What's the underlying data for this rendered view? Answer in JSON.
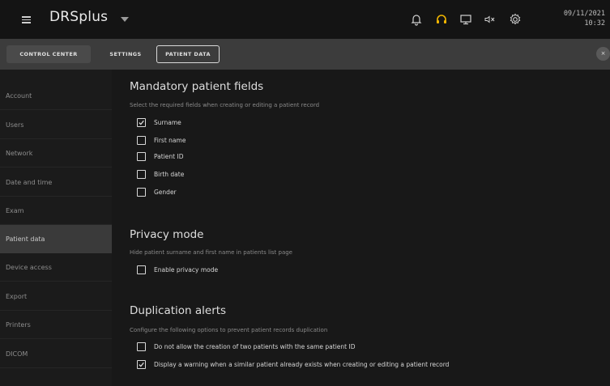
{
  "topbar": {
    "app_title": "DRSplus",
    "date": "09/11/2021",
    "time": "10:32",
    "icons": [
      "menu-icon",
      "bell-icon",
      "headset-icon",
      "monitor-icon",
      "speaker-muted-icon",
      "gear-icon"
    ],
    "headset_color": "#f2b600"
  },
  "tabs": [
    {
      "label": "CONTROL CENTER"
    },
    {
      "label": "SETTINGS"
    },
    {
      "label": "PATIENT DATA"
    }
  ],
  "close_label": "×",
  "sidebar": {
    "items": [
      {
        "label": "Account"
      },
      {
        "label": "Users"
      },
      {
        "label": "Network"
      },
      {
        "label": "Date and time"
      },
      {
        "label": "Exam"
      },
      {
        "label": "Patient data",
        "active": true
      },
      {
        "label": "Device access"
      },
      {
        "label": "Export"
      },
      {
        "label": "Printers"
      },
      {
        "label": "DICOM"
      }
    ]
  },
  "sections": {
    "mandatory": {
      "title": "Mandatory patient fields",
      "subtitle": "Select the required fields when creating or editing a patient record",
      "fields": [
        {
          "label": "Surname",
          "checked": true
        },
        {
          "label": "First name",
          "checked": false
        },
        {
          "label": "Patient ID",
          "checked": false
        },
        {
          "label": "Birth date",
          "checked": false
        },
        {
          "label": "Gender",
          "checked": false
        }
      ]
    },
    "privacy": {
      "title": "Privacy mode",
      "subtitle": "Hide patient surname and first name in patients list page",
      "fields": [
        {
          "label": "Enable privacy mode",
          "checked": false
        }
      ]
    },
    "duplication": {
      "title": "Duplication alerts",
      "subtitle": "Configure the following options to prevent patient records duplication",
      "fields": [
        {
          "label": "Do not allow the creation of two patients with the same patient ID",
          "checked": false
        },
        {
          "label": "Display a warning when a similar patient already exists when creating or editing a patient record",
          "checked": true
        }
      ]
    }
  }
}
